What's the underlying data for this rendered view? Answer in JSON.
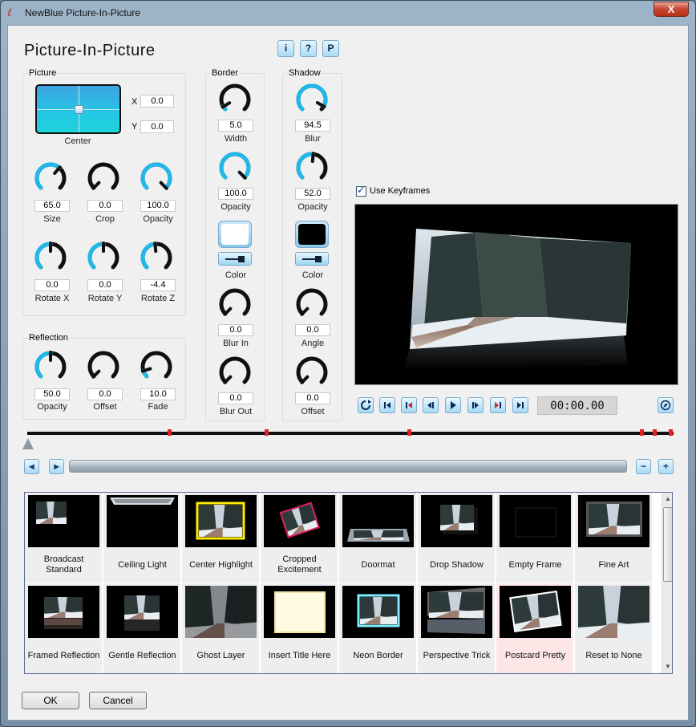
{
  "window": {
    "title": "NewBlue Picture-In-Picture",
    "close_label": "X"
  },
  "header": {
    "title": "Picture-In-Picture",
    "buttons": [
      "i",
      "?",
      "P"
    ]
  },
  "picture": {
    "label": "Picture",
    "pad_label": "Center",
    "x_label": "X",
    "x_value": "0.0",
    "y_label": "Y",
    "y_value": "0.0",
    "knobs": [
      {
        "label": "Size",
        "value": "65.0",
        "level": 0.65
      },
      {
        "label": "Crop",
        "value": "0.0",
        "level": 0.0
      },
      {
        "label": "Opacity",
        "value": "100.0",
        "level": 1.0
      },
      {
        "label": "Rotate X",
        "value": "0.0",
        "level": 0.5
      },
      {
        "label": "Rotate Y",
        "value": "0.0",
        "level": 0.5
      },
      {
        "label": "Rotate Z",
        "value": "-4.4",
        "level": 0.48
      }
    ]
  },
  "reflection": {
    "label": "Reflection",
    "knobs": [
      {
        "label": "Opacity",
        "value": "50.0",
        "level": 0.5
      },
      {
        "label": "Offset",
        "value": "0.0",
        "level": 0.0
      },
      {
        "label": "Fade",
        "value": "10.0",
        "level": 0.1
      }
    ]
  },
  "border": {
    "label": "Border",
    "width": {
      "label": "Width",
      "value": "5.0",
      "level": 0.05
    },
    "opacity": {
      "label": "Opacity",
      "value": "100.0",
      "level": 1.0
    },
    "color_label": "Color",
    "color": "#ffffff",
    "blur_in": {
      "label": "Blur In",
      "value": "0.0",
      "level": 0.0
    },
    "blur_out": {
      "label": "Blur Out",
      "value": "0.0",
      "level": 0.0
    }
  },
  "shadow": {
    "label": "Shadow",
    "blur": {
      "label": "Blur",
      "value": "94.5",
      "level": 0.945
    },
    "opacity": {
      "label": "Opacity",
      "value": "52.0",
      "level": 0.52
    },
    "color_label": "Color",
    "color": "#000000",
    "angle": {
      "label": "Angle",
      "value": "0.0",
      "level": 0.0
    },
    "offset": {
      "label": "Offset",
      "value": "0.0",
      "level": 0.0
    }
  },
  "keyframes": {
    "label": "Use Keyframes",
    "checked": true
  },
  "transport": {
    "timecode": "00:00.00",
    "icons": [
      "loop-icon",
      "go-start-icon",
      "prev-keyframe-icon",
      "step-back-icon",
      "play-icon",
      "step-forward-icon",
      "next-keyframe-icon",
      "go-end-icon"
    ]
  },
  "timeline": {
    "keyframe_positions": [
      0.22,
      0.37,
      0.59,
      0.95,
      0.97,
      0.995
    ]
  },
  "zoom": {
    "minus": "−",
    "plus": "+"
  },
  "presets": [
    {
      "name": "Broadcast Standard",
      "style": "broadcast"
    },
    {
      "name": "Ceiling Light",
      "style": "ceiling"
    },
    {
      "name": "Center Highlight",
      "style": "highlight"
    },
    {
      "name": "Cropped Excitement",
      "style": "cropped"
    },
    {
      "name": "Doormat",
      "style": "doormat"
    },
    {
      "name": "Drop Shadow",
      "style": "dropshadow"
    },
    {
      "name": "Empty Frame",
      "style": "empty"
    },
    {
      "name": "Fine Art",
      "style": "fineart"
    },
    {
      "name": "Framed Reflection",
      "style": "framedref"
    },
    {
      "name": "Gentle Reflection",
      "style": "gentleref"
    },
    {
      "name": "Ghost Layer",
      "style": "ghost"
    },
    {
      "name": "Insert Title Here",
      "style": "title"
    },
    {
      "name": "Neon Border",
      "style": "neon"
    },
    {
      "name": "Perspective Trick",
      "style": "perspective"
    },
    {
      "name": "Postcard Pretty",
      "style": "postcard",
      "selected": true
    },
    {
      "name": "Reset to None",
      "style": "reset"
    }
  ],
  "footer": {
    "ok": "OK",
    "cancel": "Cancel"
  }
}
